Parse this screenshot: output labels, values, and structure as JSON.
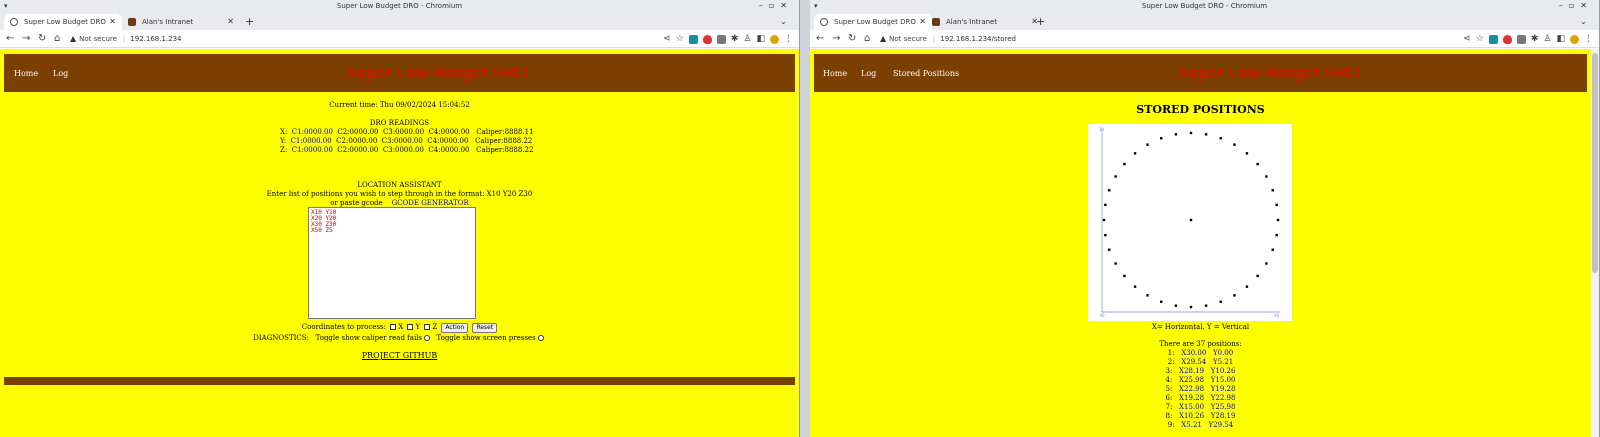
{
  "left": {
    "window_title": "Super Low Budget DRO - Chromium",
    "tabs": [
      {
        "label": "Super Low Budget DRO",
        "active": true
      },
      {
        "label": "Alan's Intranet",
        "active": false
      }
    ],
    "omnibox": {
      "security": "Not secure",
      "url": "192.168.1.234"
    },
    "menu": [
      "Home",
      "Log"
    ],
    "title": "Super Low Budget DRO",
    "current_time": "Current time: Thu 09/02/2024 15:04:52",
    "dro_heading": "DRO READINGS",
    "dro_rows": [
      {
        "axis": "X:",
        "c1": "C1:0000.00",
        "rest": "C2:0000.00  C3:0000.00  C4:0000.00   Caliper:8888.11"
      },
      {
        "axis": "Y:",
        "c1": "C1:0000.00",
        "rest": "C2:0000.00  C3:0000.00  C4:0000.00   Caliper:8888.22"
      },
      {
        "axis": "Z:",
        "c1": "C1:0000.00",
        "rest": "C2:0000.00  C3:0000.00  C4:0000.00   Caliper:8888.22"
      }
    ],
    "location_heading": "LOCATION ASSISTANT",
    "location_help": "Enter list of positions you wish to step through in the format: X10 Y20 Z30",
    "paste_text": "or paste gcode",
    "gcode_link": "GCODE GENERATOR",
    "textarea_lines": [
      "X10 Y10",
      "X20 Y20",
      "X30 Z30",
      "X50 Z5"
    ],
    "coords_label": "Coordinates to process:",
    "axes": [
      "X",
      "Y",
      "Z"
    ],
    "action_button": "Action",
    "reset_button": "Reset",
    "diagnostics_label": "DIAGNOSTICS:",
    "toggle_caliper": "Toggle show caliper read fails",
    "toggle_screen": "Toggle show screen presses",
    "github_link": "PROJECT GITHUB"
  },
  "right": {
    "window_title": "Super Low Budget DRO - Chromium",
    "tabs": [
      {
        "label": "Super Low Budget DRO",
        "active": true
      },
      {
        "label": "Alan's Intranet",
        "active": false
      }
    ],
    "omnibox": {
      "security": "Not secure",
      "url": "192.168.1.234/stored"
    },
    "menu": [
      "Home",
      "Log",
      "Stored Positions"
    ],
    "title": "Super Low Budget DRO",
    "heading": "STORED POSITIONS",
    "plot_caption": "X= Horizontal, Y = Vertical",
    "count_text": "There are 37 positions:",
    "axis_labels": {
      "ymax": "30",
      "xmin": "-30",
      "xmax": "30"
    },
    "positions": [
      {
        "n": "1:",
        "x": "X30.00",
        "y": "Y0.00"
      },
      {
        "n": "2:",
        "x": "X29.54",
        "y": "Y5.21"
      },
      {
        "n": "3:",
        "x": "X28.19",
        "y": "Y10.26"
      },
      {
        "n": "4:",
        "x": "X25.98",
        "y": "Y15.00"
      },
      {
        "n": "5:",
        "x": "X22.98",
        "y": "Y19.28"
      },
      {
        "n": "6:",
        "x": "X19.28",
        "y": "Y22.98"
      },
      {
        "n": "7:",
        "x": "X15.00",
        "y": "Y25.98"
      },
      {
        "n": "8:",
        "x": "X10.26",
        "y": "Y28.19"
      },
      {
        "n": "9:",
        "x": "X5.21",
        "y": "Y29.54"
      }
    ],
    "plot_points": {
      "radius": 30,
      "count": 36,
      "center": [
        0,
        0
      ]
    }
  }
}
